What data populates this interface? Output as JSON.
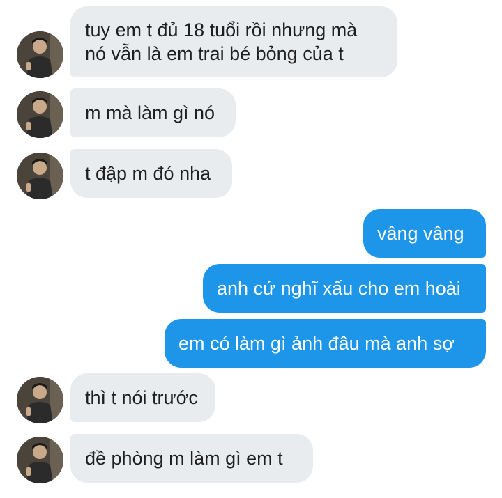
{
  "conversation": {
    "colors": {
      "incoming_bubble": "#e9ecef",
      "outgoing_bubble": "#1d95e8",
      "incoming_text": "#1f1f1f",
      "outgoing_text": "#ffffff"
    },
    "avatar_icon": "profile-photo",
    "messages": [
      {
        "direction": "incoming",
        "lines": [
          "tuy em t đủ 18 tuổi rồi nhưng mà",
          "nó vẫn là em trai bé bỏng của t"
        ]
      },
      {
        "direction": "incoming",
        "lines": [
          "m mà làm gì nó"
        ]
      },
      {
        "direction": "incoming",
        "lines": [
          "t đập m đó nha"
        ]
      },
      {
        "direction": "outgoing",
        "lines": [
          "vâng vâng"
        ]
      },
      {
        "direction": "outgoing",
        "lines": [
          "anh cứ nghĩ xấu cho em hoài"
        ]
      },
      {
        "direction": "outgoing",
        "lines": [
          "em có làm gì ảnh đâu mà anh sợ"
        ]
      },
      {
        "direction": "incoming",
        "lines": [
          "thì t nói trước"
        ]
      },
      {
        "direction": "incoming",
        "lines": [
          "đề phòng m làm gì em t"
        ]
      }
    ]
  }
}
